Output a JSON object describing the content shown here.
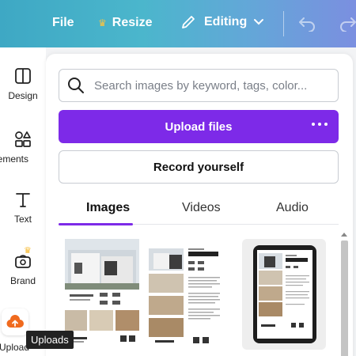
{
  "topbar": {
    "file_label": "File",
    "resize_label": "Resize",
    "editing_label": "Editing",
    "icons": [
      "menu-icon",
      "crown-icon",
      "pencil-icon",
      "chevron-down-icon",
      "undo-icon",
      "redo-icon"
    ]
  },
  "leftrail": {
    "items": [
      {
        "label": "Design",
        "icon": "layout-icon"
      },
      {
        "label": "lements",
        "icon": "shapes-icon"
      },
      {
        "label": "Text",
        "icon": "text-icon"
      },
      {
        "label": "Brand",
        "icon": "brand-icon"
      },
      {
        "label": "Upload",
        "icon": "upload-cloud-icon"
      }
    ]
  },
  "panel": {
    "search_placeholder": "Search images by keyword, tags, color...",
    "upload_label": "Upload files",
    "record_label": "Record yourself",
    "tabs": [
      {
        "label": "Images",
        "active": true
      },
      {
        "label": "Videos",
        "active": false
      },
      {
        "label": "Audio",
        "active": false
      }
    ],
    "thumb1": {
      "brand_a": "MATTHEW BROWN",
      "brand_b": "kw"
    },
    "thumb2": {
      "heading_small": "PROPERTY",
      "heading": "FEATURES",
      "brand_a": "MATTHEW BROWN",
      "brand_b": "kw"
    },
    "thumb3": {
      "heading_small": "PROPERTY",
      "heading": "FEATURES"
    }
  },
  "tooltip": {
    "text": "Uploads"
  },
  "colors": {
    "accent": "#7d2ae8",
    "topbar_start": "#3ea8c4",
    "topbar_end": "#7b8fe0",
    "brand_crown": "#f6b82b"
  }
}
